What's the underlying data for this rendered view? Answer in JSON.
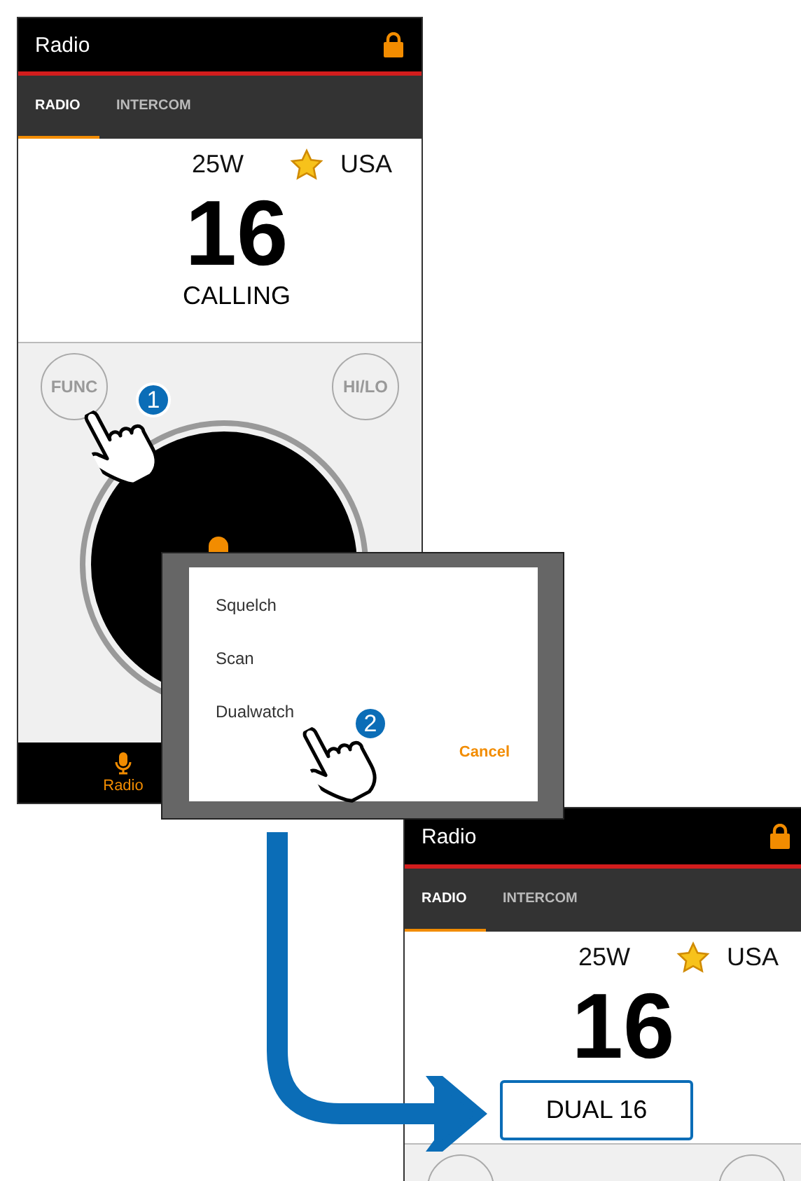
{
  "screen_before": {
    "title": "Radio",
    "locked": true,
    "tabs": [
      {
        "label": "RADIO",
        "selected": true
      },
      {
        "label": "INTERCOM",
        "selected": false
      }
    ],
    "power": "25W",
    "favorite": true,
    "region": "USA",
    "channel": "16",
    "status": {
      "text": "CALLING",
      "highlighted": false
    },
    "buttons": [
      "FUNC",
      "HI/LO"
    ],
    "nav": [
      {
        "label": "Radio",
        "selected": true
      }
    ]
  },
  "menu_dialog": {
    "items": [
      "Squelch",
      "Scan",
      "Dualwatch"
    ],
    "cancel": "Cancel"
  },
  "screen_after": {
    "title": "Radio",
    "locked": true,
    "tabs": [
      {
        "label": "RADIO",
        "selected": true
      },
      {
        "label": "INTERCOM",
        "selected": false
      }
    ],
    "power": "25W",
    "favorite": true,
    "region": "USA",
    "channel": "16",
    "status": {
      "text": "DUAL 16",
      "highlighted": true
    }
  },
  "steps": [
    {
      "badge": "1"
    },
    {
      "badge": "2"
    }
  ]
}
